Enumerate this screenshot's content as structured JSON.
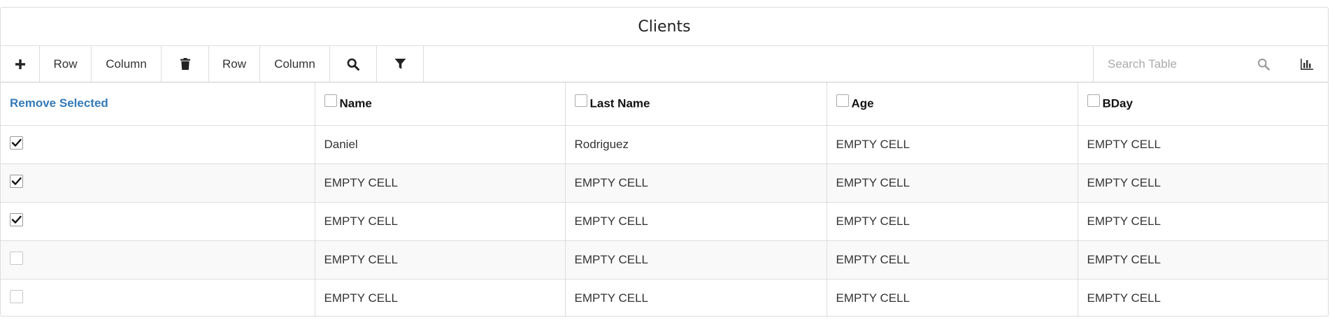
{
  "title": "Clients",
  "toolbar": {
    "add_icon": "plus-icon",
    "add_row_label": "Row",
    "add_column_label": "Column",
    "delete_icon": "trash-icon",
    "delete_row_label": "Row",
    "delete_column_label": "Column",
    "search_toggle_icon": "search-icon",
    "filter_icon": "filter-icon",
    "search_placeholder": "Search Table",
    "search_value": "",
    "chart_icon": "bar-chart-icon"
  },
  "table": {
    "remove_selected_label": "Remove Selected",
    "columns": [
      {
        "label": "Name",
        "checked": false
      },
      {
        "label": "Last Name",
        "checked": false
      },
      {
        "label": "Age",
        "checked": false
      },
      {
        "label": "BDay",
        "checked": false
      }
    ],
    "rows": [
      {
        "checked": true,
        "cells": [
          "Daniel",
          "Rodriguez",
          "EMPTY CELL",
          "EMPTY CELL"
        ]
      },
      {
        "checked": true,
        "cells": [
          "EMPTY CELL",
          "EMPTY CELL",
          "EMPTY CELL",
          "EMPTY CELL"
        ]
      },
      {
        "checked": true,
        "cells": [
          "EMPTY CELL",
          "EMPTY CELL",
          "EMPTY CELL",
          "EMPTY CELL"
        ]
      },
      {
        "checked": false,
        "cells": [
          "EMPTY CELL",
          "EMPTY CELL",
          "EMPTY CELL",
          "EMPTY CELL"
        ]
      },
      {
        "checked": false,
        "cells": [
          "EMPTY CELL",
          "EMPTY CELL",
          "EMPTY CELL",
          "EMPTY CELL"
        ]
      }
    ]
  },
  "colors": {
    "link": "#337ab7",
    "border": "#dddddd",
    "stripe": "#f9f9f9"
  }
}
